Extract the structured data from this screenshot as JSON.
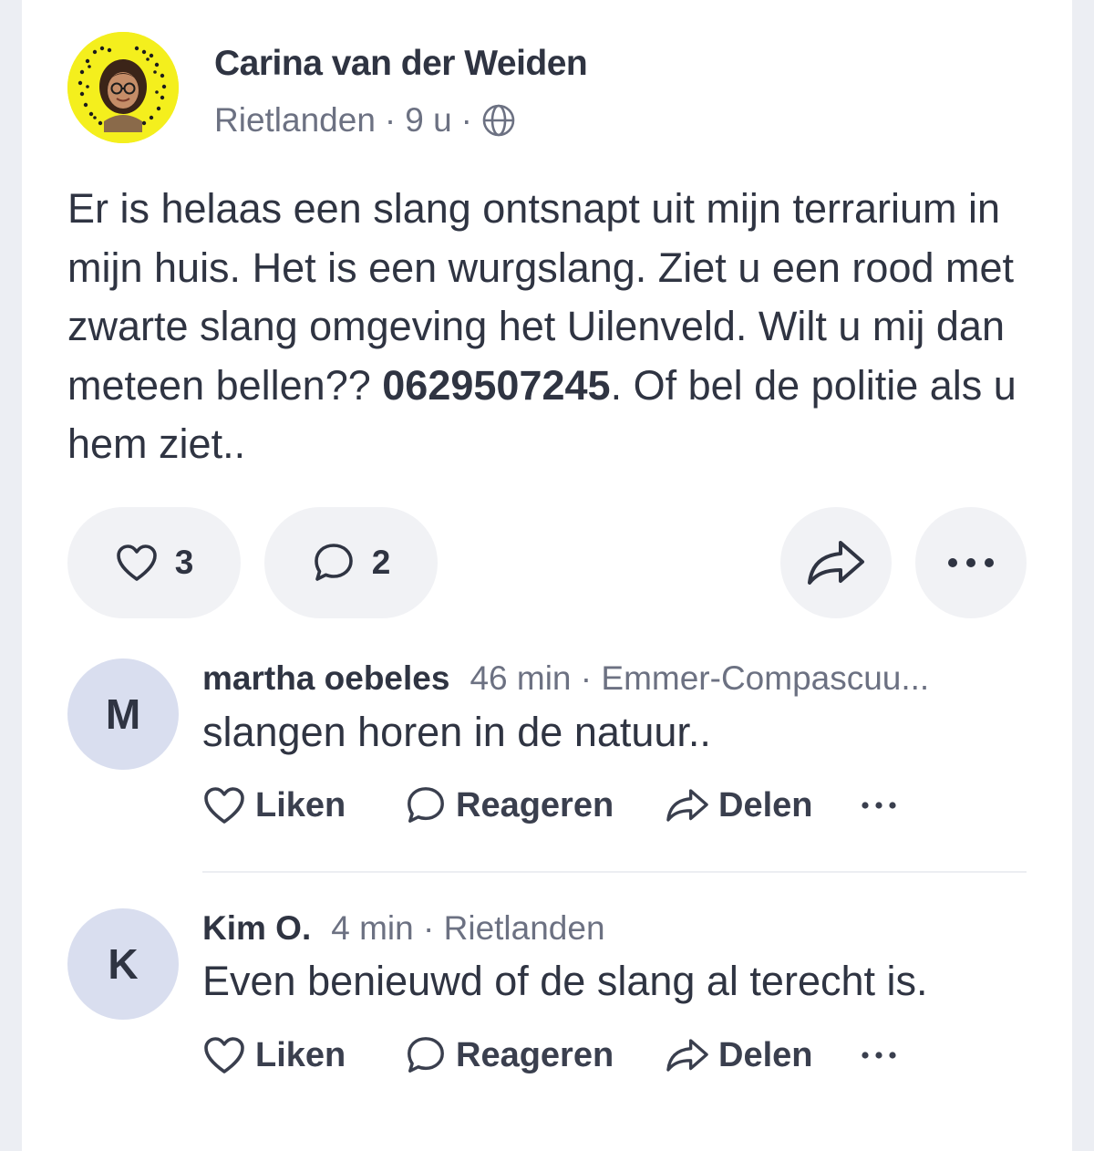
{
  "post": {
    "author": "Carina van der Weiden",
    "location": "Rietlanden",
    "time": "9 u",
    "body_text": "Er is helaas een slang ontsnapt uit mijn terrarium in mijn huis. Het is een wurgslang. Ziet u een rood met zwarte slang omgeving het Uilenveld. Wilt u mij dan meteen bellen??",
    "phone": "0629507245",
    "body_suffix": ". Of bel de politie als u hem ziet..",
    "likes": "3",
    "comments": "2"
  },
  "comments": [
    {
      "initial": "M",
      "name": "martha oebeles",
      "time": "46 min",
      "location": "Emmer-Compascuu...",
      "text": "slangen horen in de natuur..",
      "like_label": "Liken",
      "reply_label": "Reageren",
      "share_label": "Delen"
    },
    {
      "initial": "K",
      "name": "Kim O.",
      "time": "4 min",
      "location": "Rietlanden",
      "text": "Even benieuwd of de slang al terecht is.",
      "like_label": "Liken",
      "reply_label": "Reageren",
      "share_label": "Delen"
    }
  ],
  "colors": {
    "background": "#eceef3",
    "card": "#ffffff",
    "pill": "#f1f2f5",
    "comment_avatar": "#d9deef",
    "snapcode_yellow": "#f4ef1d"
  },
  "icons": {
    "visibility": "globe-icon",
    "like": "heart-icon",
    "comment": "comment-bubble-icon",
    "share": "share-arrow-icon",
    "more": "more-dots-icon"
  }
}
